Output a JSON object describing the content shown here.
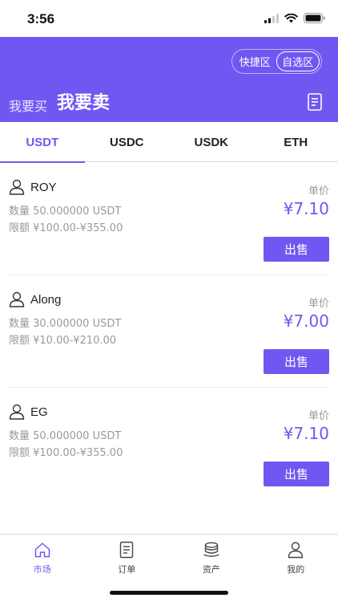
{
  "status_bar": {
    "time": "3:56"
  },
  "header": {
    "mode_options": [
      "快捷区",
      "自选区"
    ],
    "active_mode": 1,
    "trade_tabs": {
      "buy": "我要买",
      "sell": "我要卖"
    },
    "active_trade_tab": "sell",
    "accent_color": "#6f58f2"
  },
  "coin_tabs": [
    {
      "label": "USDT"
    },
    {
      "label": "USDC"
    },
    {
      "label": "USDK"
    },
    {
      "label": "ETH"
    }
  ],
  "active_coin_tab": 0,
  "listings": [
    {
      "name": "ROY",
      "quantity": "数量 50.000000 USDT",
      "limit": "限额 ¥100.00-¥355.00",
      "price_label": "单价",
      "price": "¥7.10",
      "action": "出售"
    },
    {
      "name": "Along",
      "quantity": "数量 30.000000 USDT",
      "limit": "限额 ¥10.00-¥210.00",
      "price_label": "单价",
      "price": "¥7.00",
      "action": "出售"
    },
    {
      "name": "EG",
      "quantity": "数量 50.000000 USDT",
      "limit": "限额 ¥100.00-¥355.00",
      "price_label": "单价",
      "price": "¥7.10",
      "action": "出售"
    }
  ],
  "bottom_nav": [
    {
      "label": "市场",
      "icon": "home-icon"
    },
    {
      "label": "订单",
      "icon": "order-icon"
    },
    {
      "label": "资产",
      "icon": "coins-icon"
    },
    {
      "label": "我的",
      "icon": "profile-icon"
    }
  ],
  "active_nav": 0
}
